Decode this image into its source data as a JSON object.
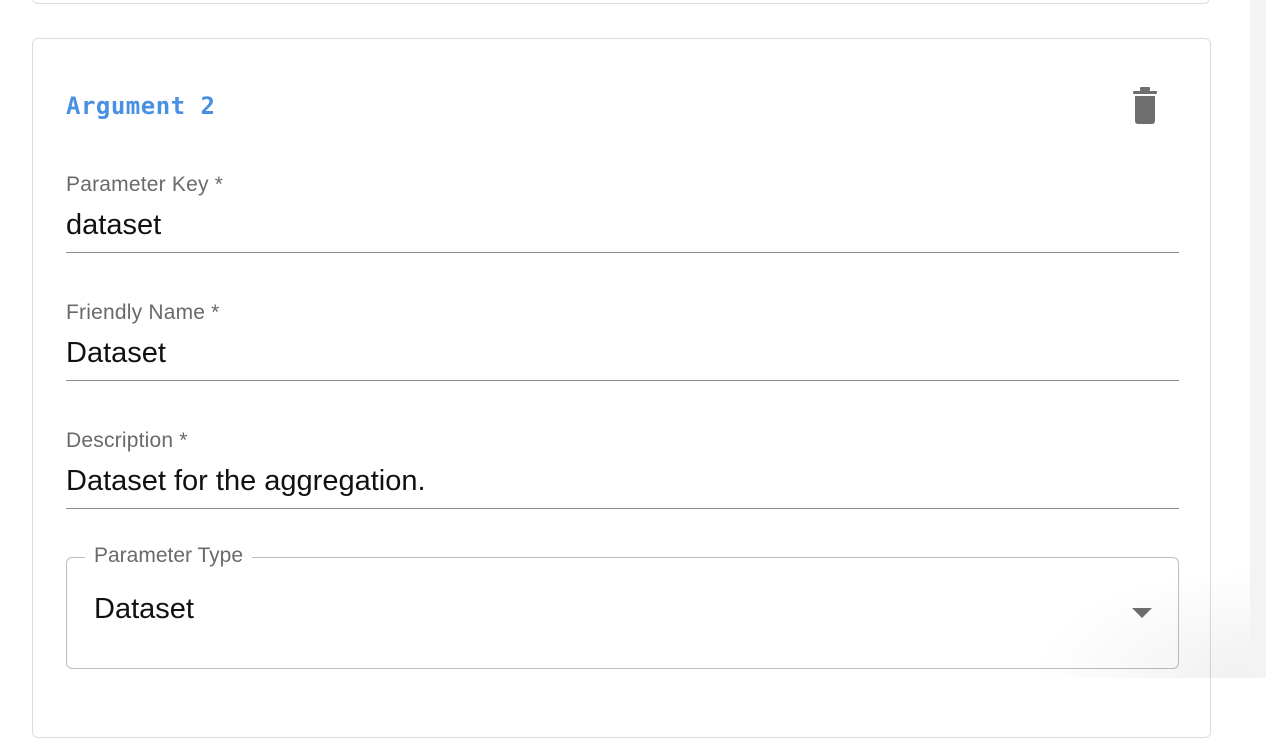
{
  "argument": {
    "title": "Argument 2",
    "delete_icon": "trash-icon"
  },
  "fields": {
    "parameter_key": {
      "label": "Parameter Key *",
      "value": "dataset"
    },
    "friendly_name": {
      "label": "Friendly Name *",
      "value": "Dataset"
    },
    "description": {
      "label": "Description *",
      "value": "Dataset for the aggregation."
    },
    "parameter_type": {
      "label": "Parameter Type",
      "value": "Dataset",
      "icon": "chevron-down-icon"
    }
  },
  "colors": {
    "accent": "#4a90e2",
    "icon": "#6e6e6e",
    "label": "#6a6a6a"
  }
}
